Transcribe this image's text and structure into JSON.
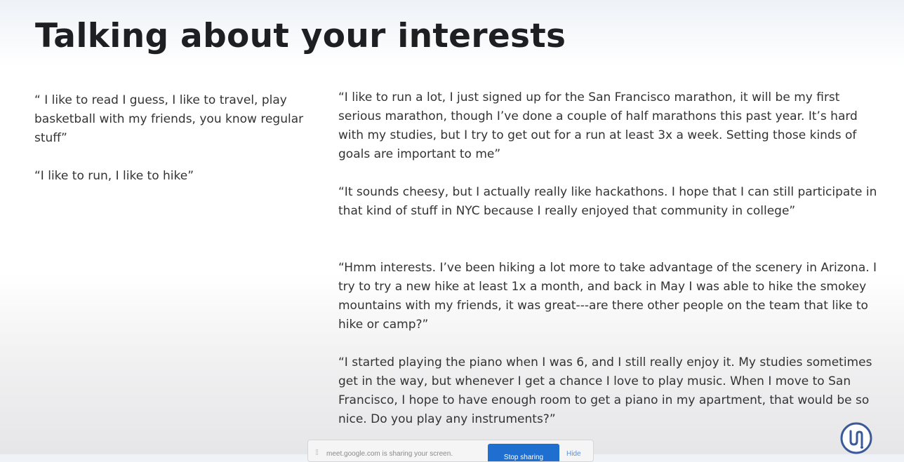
{
  "slide": {
    "title": "Talking about your interests"
  },
  "left_quotes": [
    "“ I like to read I guess, I like to travel, play basketball with my friends, you know regular stuff”",
    "“I like to run, I like to hike”"
  ],
  "right_quotes": [
    "“I like to run a lot, I just signed up for the San Francisco marathon, it will be my first serious marathon, though I’ve done a couple of half marathons this past year. It’s hard with my studies, but I try to get out for a run at least 3x a week. Setting those kinds of goals are important to me”",
    "“It sounds cheesy, but I actually really like hackathons. I hope that I can still participate in that kind of stuff in NYC because I really enjoyed that community in college”",
    "“Hmm interests. I’ve been hiking a lot more to take advantage of the scenery in Arizona. I try to try a new hike at least 1x a month, and back in May I was able to hike the smokey mountains with my friends, it was great---are there other people on the team that like to hike or camp?”",
    "“I started playing the piano when I was 6, and I still really enjoy it. My studies sometimes get in the way, but whenever I get a chance I love to play music. When I move to San Francisco, I hope to have enough room to get a piano in my apartment, that would be so nice. Do you play any instruments?”"
  ],
  "screenshare_bar": {
    "grip_icon": "drag-grip-icon",
    "message": "meet.google.com is sharing your screen.",
    "stop_label": "Stop sharing",
    "hide_label": "Hide"
  },
  "logo": {
    "icon": "brand-logo-icon",
    "color": "#3a5a9a"
  }
}
